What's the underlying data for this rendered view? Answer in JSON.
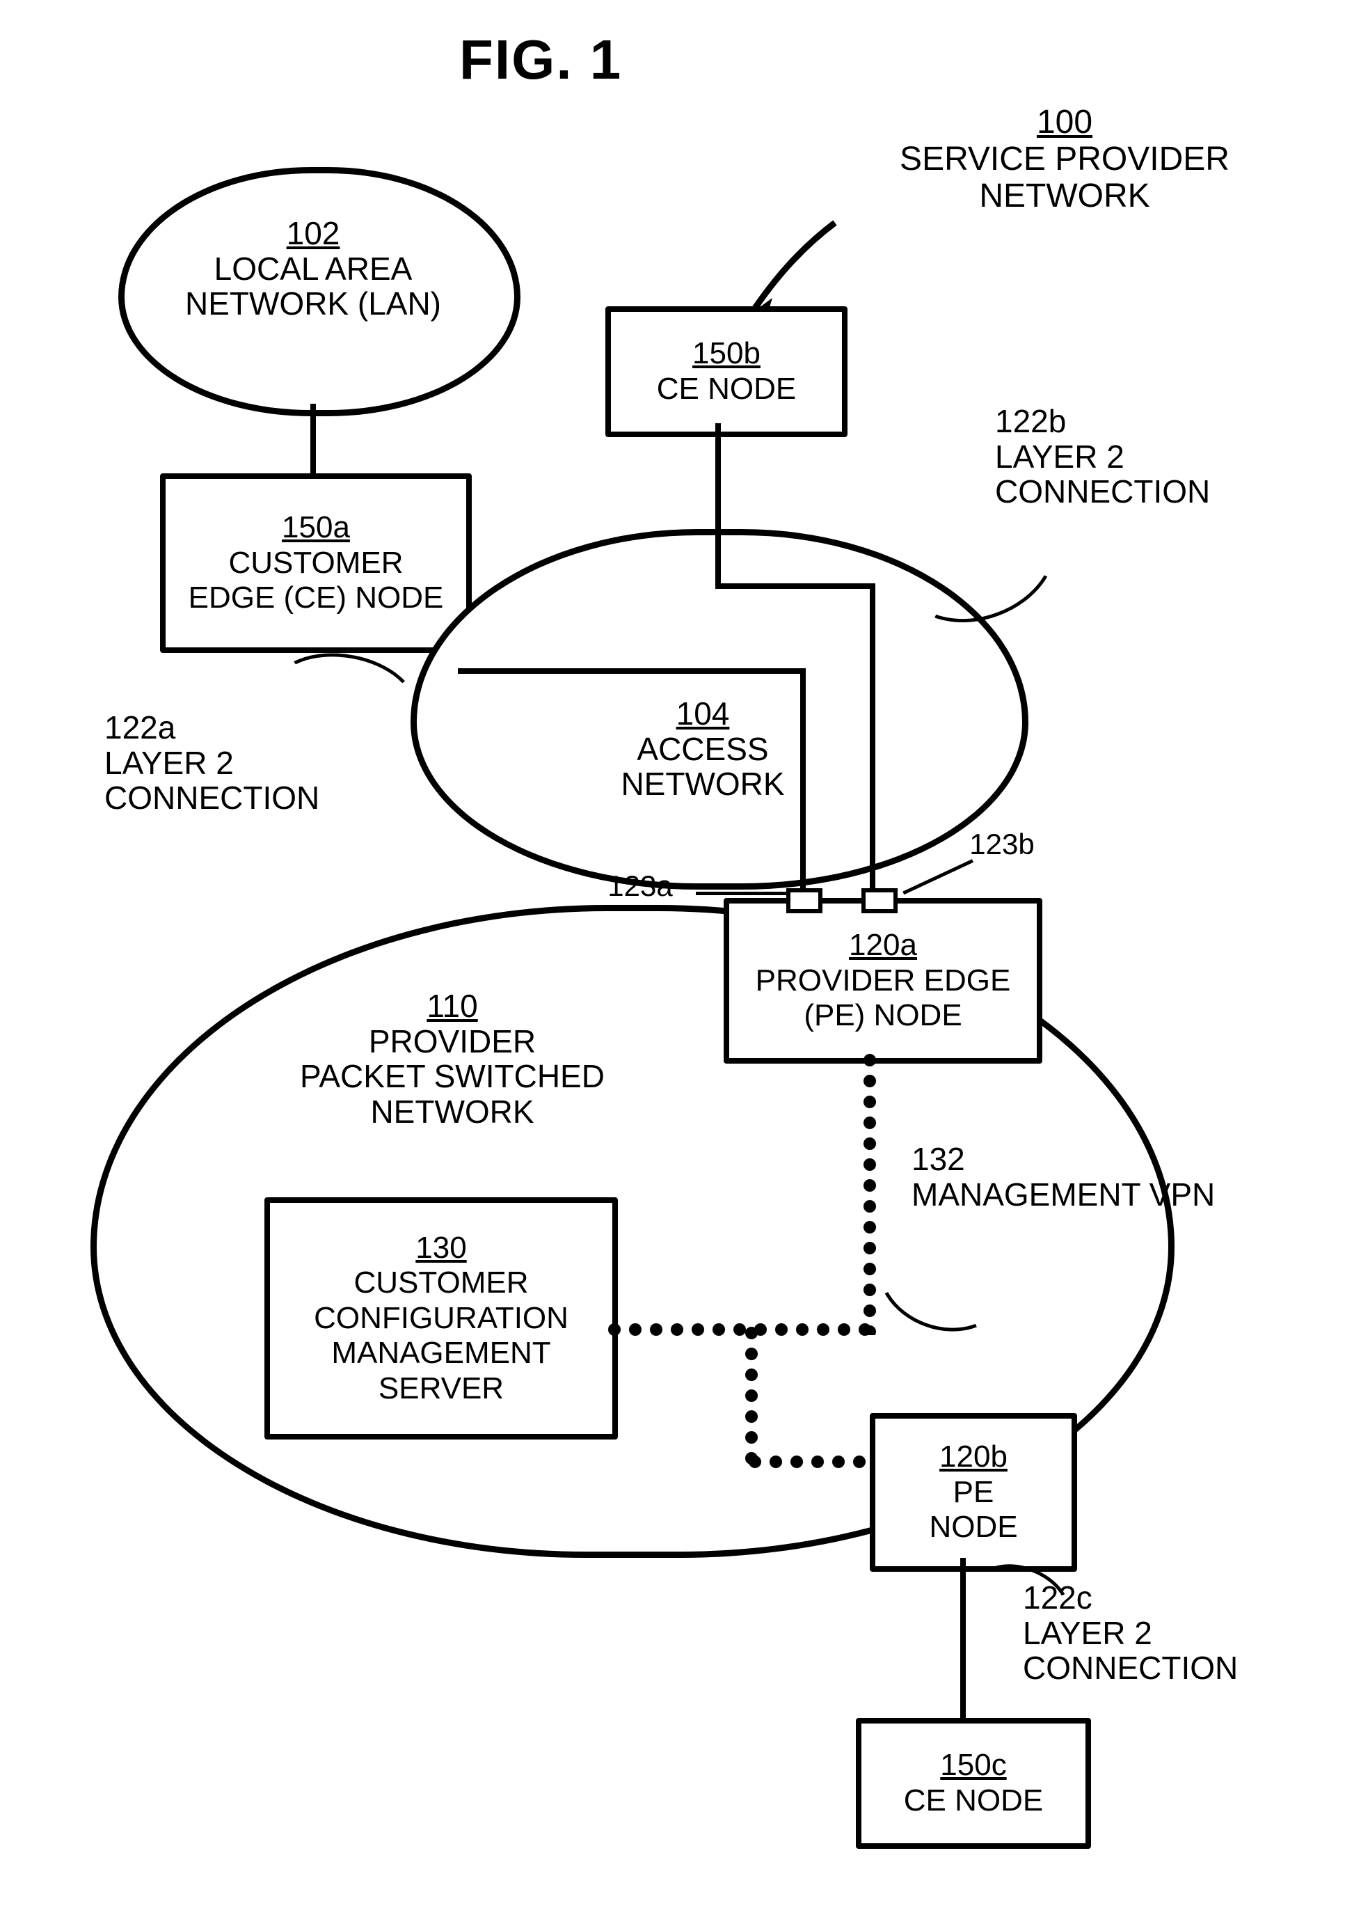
{
  "figure": {
    "title": "FIG. 1"
  },
  "callout_100": {
    "num": "100",
    "text": "SERVICE PROVIDER\nNETWORK"
  },
  "lan": {
    "num": "102",
    "text": "LOCAL AREA\nNETWORK (LAN)"
  },
  "access": {
    "num": "104",
    "text": "ACCESS\nNETWORK"
  },
  "ppsn": {
    "num": "110",
    "text": "PROVIDER\nPACKET SWITCHED\nNETWORK"
  },
  "ce_a": {
    "num": "150a",
    "text": "CUSTOMER\nEDGE (CE) NODE"
  },
  "ce_b": {
    "num": "150b",
    "text": "CE NODE"
  },
  "ce_c": {
    "num": "150c",
    "text": "CE NODE"
  },
  "pe_a": {
    "num": "120a",
    "text": "PROVIDER EDGE\n(PE) NODE"
  },
  "pe_b": {
    "num": "120b",
    "text": "PE\nNODE"
  },
  "ccms": {
    "num": "130",
    "text": "CUSTOMER\nCONFIGURATION\nMANAGEMENT\nSERVER"
  },
  "conn_122a": {
    "num": "122a",
    "text": "LAYER 2\nCONNECTION"
  },
  "conn_122b": {
    "num": "122b",
    "text": "LAYER 2\nCONNECTION"
  },
  "conn_122c": {
    "num": "122c",
    "text": "LAYER 2\nCONNECTION"
  },
  "port_123a": {
    "num": "123a"
  },
  "port_123b": {
    "num": "123b"
  },
  "mvpn": {
    "num": "132",
    "text": "MANAGEMENT VPN"
  }
}
